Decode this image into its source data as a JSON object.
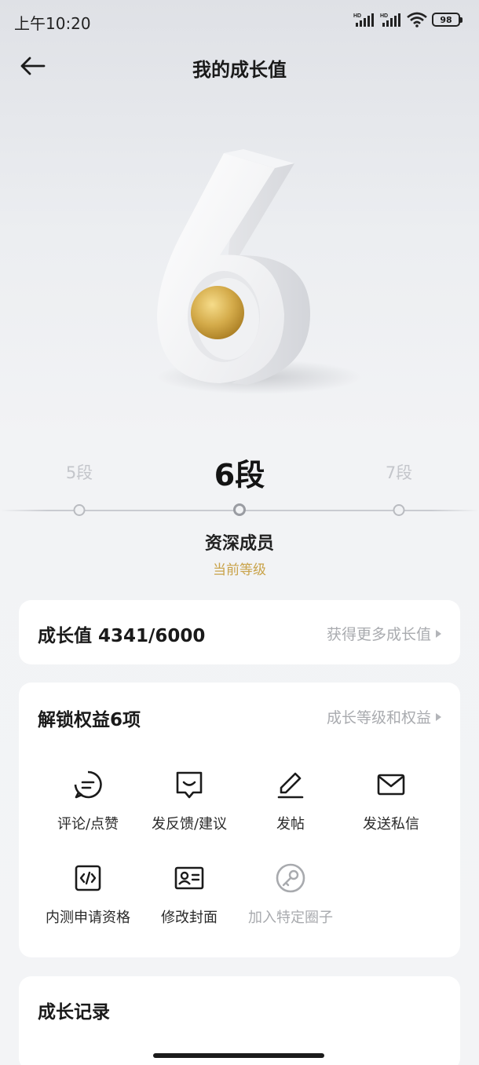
{
  "status": {
    "time": "上午10:20",
    "battery": "98"
  },
  "nav": {
    "title": "我的成长值",
    "back_icon": "arrow-left-icon"
  },
  "hero": {
    "level_digit": "6",
    "accent": "#d4ab4a"
  },
  "levels": {
    "prev": "5段",
    "current": "6段",
    "next": "7段",
    "member_title": "资深成员",
    "current_note": "当前等级"
  },
  "growth": {
    "label": "成长值 4341/6000",
    "more_link": "获得更多成长值"
  },
  "rights": {
    "title": "解锁权益6项",
    "link": "成长等级和权益",
    "items": [
      {
        "label": "评论/点赞",
        "icon": "comment-icon",
        "enabled": true
      },
      {
        "label": "发反馈/建议",
        "icon": "feedback-icon",
        "enabled": true
      },
      {
        "label": "发帖",
        "icon": "pen-icon",
        "enabled": true
      },
      {
        "label": "发送私信",
        "icon": "mail-icon",
        "enabled": true
      },
      {
        "label": "内测申请资格",
        "icon": "code-icon",
        "enabled": true
      },
      {
        "label": "修改封面",
        "icon": "id-card-icon",
        "enabled": true
      },
      {
        "label": "加入特定圈子",
        "icon": "key-icon",
        "enabled": false
      }
    ]
  },
  "record": {
    "title": "成长记录"
  },
  "colors": {
    "gold": "#c9a34a",
    "muted": "#a9abaf",
    "card": "#ffffff"
  }
}
